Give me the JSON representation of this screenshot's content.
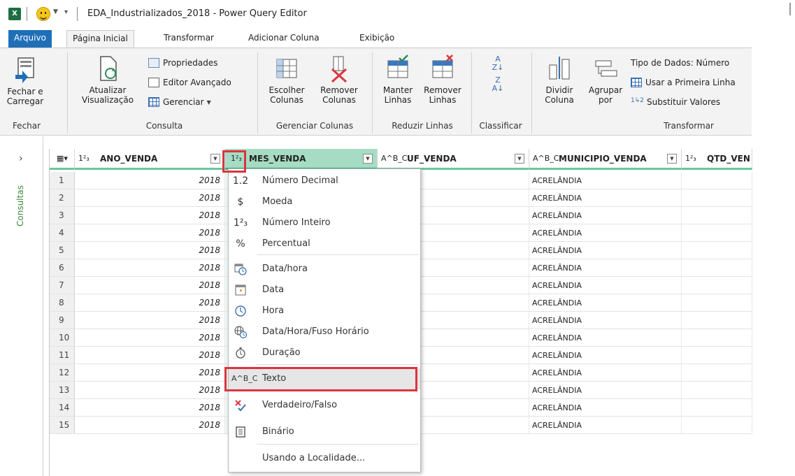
{
  "titlebar": {
    "app_icon": "X",
    "title": "EDA_Industrializados_2018 - Power Query Editor"
  },
  "tabs": [
    {
      "label": "Arquivo"
    },
    {
      "label": "Página Inicial"
    },
    {
      "label": "Transformar"
    },
    {
      "label": "Adicionar Coluna"
    },
    {
      "label": "Exibição"
    }
  ],
  "ribbon": {
    "fechar": {
      "button": "Fechar e\nCarregar",
      "group": "Fechar"
    },
    "consulta": {
      "atualizar": "Atualizar\nVisualização",
      "propriedades": "Propriedades",
      "editor": "Editor Avançado",
      "gerenciar": "Gerenciar",
      "group": "Consulta"
    },
    "colunas": {
      "escolher": "Escolher\nColunas",
      "remover": "Remover\nColunas",
      "group": "Gerenciar Colunas"
    },
    "linhas": {
      "manter": "Manter\nLinhas",
      "remover": "Remover\nLinhas",
      "group": "Reduzir Linhas"
    },
    "classificar": {
      "group": "Classificar"
    },
    "transformar": {
      "dividir": "Dividir\nColuna",
      "agrupar": "Agrupar\npor",
      "tipo": "Tipo de Dados: Número",
      "primeira": "Usar a Primeira Linha",
      "substituir": "Substituir Valores",
      "group": "Transformar"
    }
  },
  "queries_pane": {
    "label": "Consultas"
  },
  "columns": [
    {
      "type_icon": "1²₃",
      "name": "ANO_VENDA"
    },
    {
      "type_icon": "1²₃",
      "name": "MES_VENDA"
    },
    {
      "type_icon": "A^B_C",
      "name": "UF_VENDA"
    },
    {
      "type_icon": "A^B_C",
      "name": "MUNICIPIO_VENDA"
    },
    {
      "type_icon": "1²₃",
      "name": "QTD_VEN"
    }
  ],
  "rows": [
    {
      "n": "1",
      "ano": "2018",
      "municipio": "ACRELÂNDIA"
    },
    {
      "n": "2",
      "ano": "2018",
      "municipio": "ACRELÂNDIA"
    },
    {
      "n": "3",
      "ano": "2018",
      "municipio": "ACRELÂNDIA"
    },
    {
      "n": "4",
      "ano": "2018",
      "municipio": "ACRELÂNDIA"
    },
    {
      "n": "5",
      "ano": "2018",
      "municipio": "ACRELÂNDIA"
    },
    {
      "n": "6",
      "ano": "2018",
      "municipio": "ACRELÂNDIA"
    },
    {
      "n": "7",
      "ano": "2018",
      "municipio": "ACRELÂNDIA"
    },
    {
      "n": "8",
      "ano": "2018",
      "municipio": "ACRELÂNDIA"
    },
    {
      "n": "9",
      "ano": "2018",
      "municipio": "ACRELÂNDIA"
    },
    {
      "n": "10",
      "ano": "2018",
      "municipio": "ACRELÂNDIA"
    },
    {
      "n": "11",
      "ano": "2018",
      "municipio": "ACRELÂNDIA"
    },
    {
      "n": "12",
      "ano": "2018",
      "municipio": "ACRELÂNDIA"
    },
    {
      "n": "13",
      "ano": "2018",
      "municipio": "ACRELÂNDIA"
    },
    {
      "n": "14",
      "ano": "2018",
      "municipio": "ACRELÂNDIA"
    },
    {
      "n": "15",
      "ano": "2018",
      "municipio": "ACRELÂNDIA"
    }
  ],
  "menu": {
    "items": [
      {
        "icon": "1.2",
        "label": "Número Decimal"
      },
      {
        "icon": "$",
        "label": "Moeda"
      },
      {
        "icon": "1²₃",
        "label": "Número Inteiro"
      },
      {
        "icon": "%",
        "label": "Percentual"
      },
      {
        "icon": "datetime-icon",
        "label": "Data/hora"
      },
      {
        "icon": "calendar-icon",
        "label": "Data"
      },
      {
        "icon": "clock-icon",
        "label": "Hora"
      },
      {
        "icon": "globe-clock-icon",
        "label": "Data/Hora/Fuso Horário"
      },
      {
        "icon": "stopwatch-icon",
        "label": "Duração"
      },
      {
        "icon": "A^B_C",
        "label": "Texto"
      },
      {
        "icon": "true-false-icon",
        "label": "Verdadeiro/Falso"
      },
      {
        "icon": "binary-icon",
        "label": "Binário"
      },
      {
        "icon": "",
        "label": "Usando a Localidade..."
      }
    ]
  },
  "colors": {
    "accent": "#1f6fb8",
    "selected_header": "#a6dcc4",
    "header_underline": "#6cc69b",
    "highlight_box": "#d9363e",
    "excel_green": "#1d6f42"
  }
}
